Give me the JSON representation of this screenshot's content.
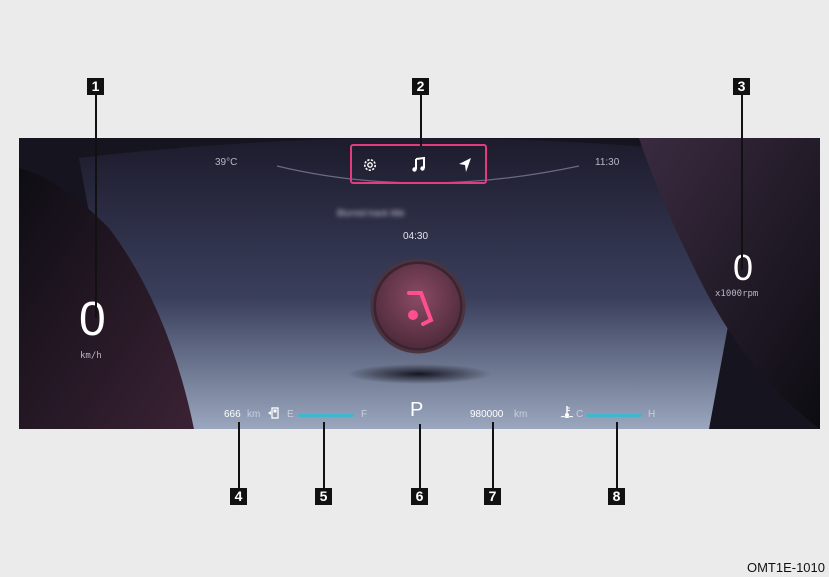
{
  "callouts": [
    "1",
    "2",
    "3",
    "4",
    "5",
    "6",
    "7",
    "8"
  ],
  "top_bar": {
    "temperature": "39°C",
    "time": "11:30",
    "icons": [
      "gear-icon",
      "music-note-icon",
      "navigation-arrow-icon"
    ]
  },
  "media": {
    "track_title": "Blurred track title",
    "elapsed": "04:30"
  },
  "speed": {
    "value": "0",
    "unit": "km/h"
  },
  "tach": {
    "value": "0",
    "unit": "x1000rpm"
  },
  "fuel": {
    "range": "666",
    "range_unit": "km",
    "empty_label": "E",
    "full_label": "F",
    "level": 0.9
  },
  "gear": "P",
  "odometer": {
    "value": "980000",
    "unit": "km"
  },
  "coolant": {
    "cold_label": "C",
    "hot_label": "H",
    "level": 0.9
  },
  "caption": "OMT1E-1010",
  "colors": {
    "accent": "#e23c7f",
    "gauge": "#3fb8cf"
  }
}
